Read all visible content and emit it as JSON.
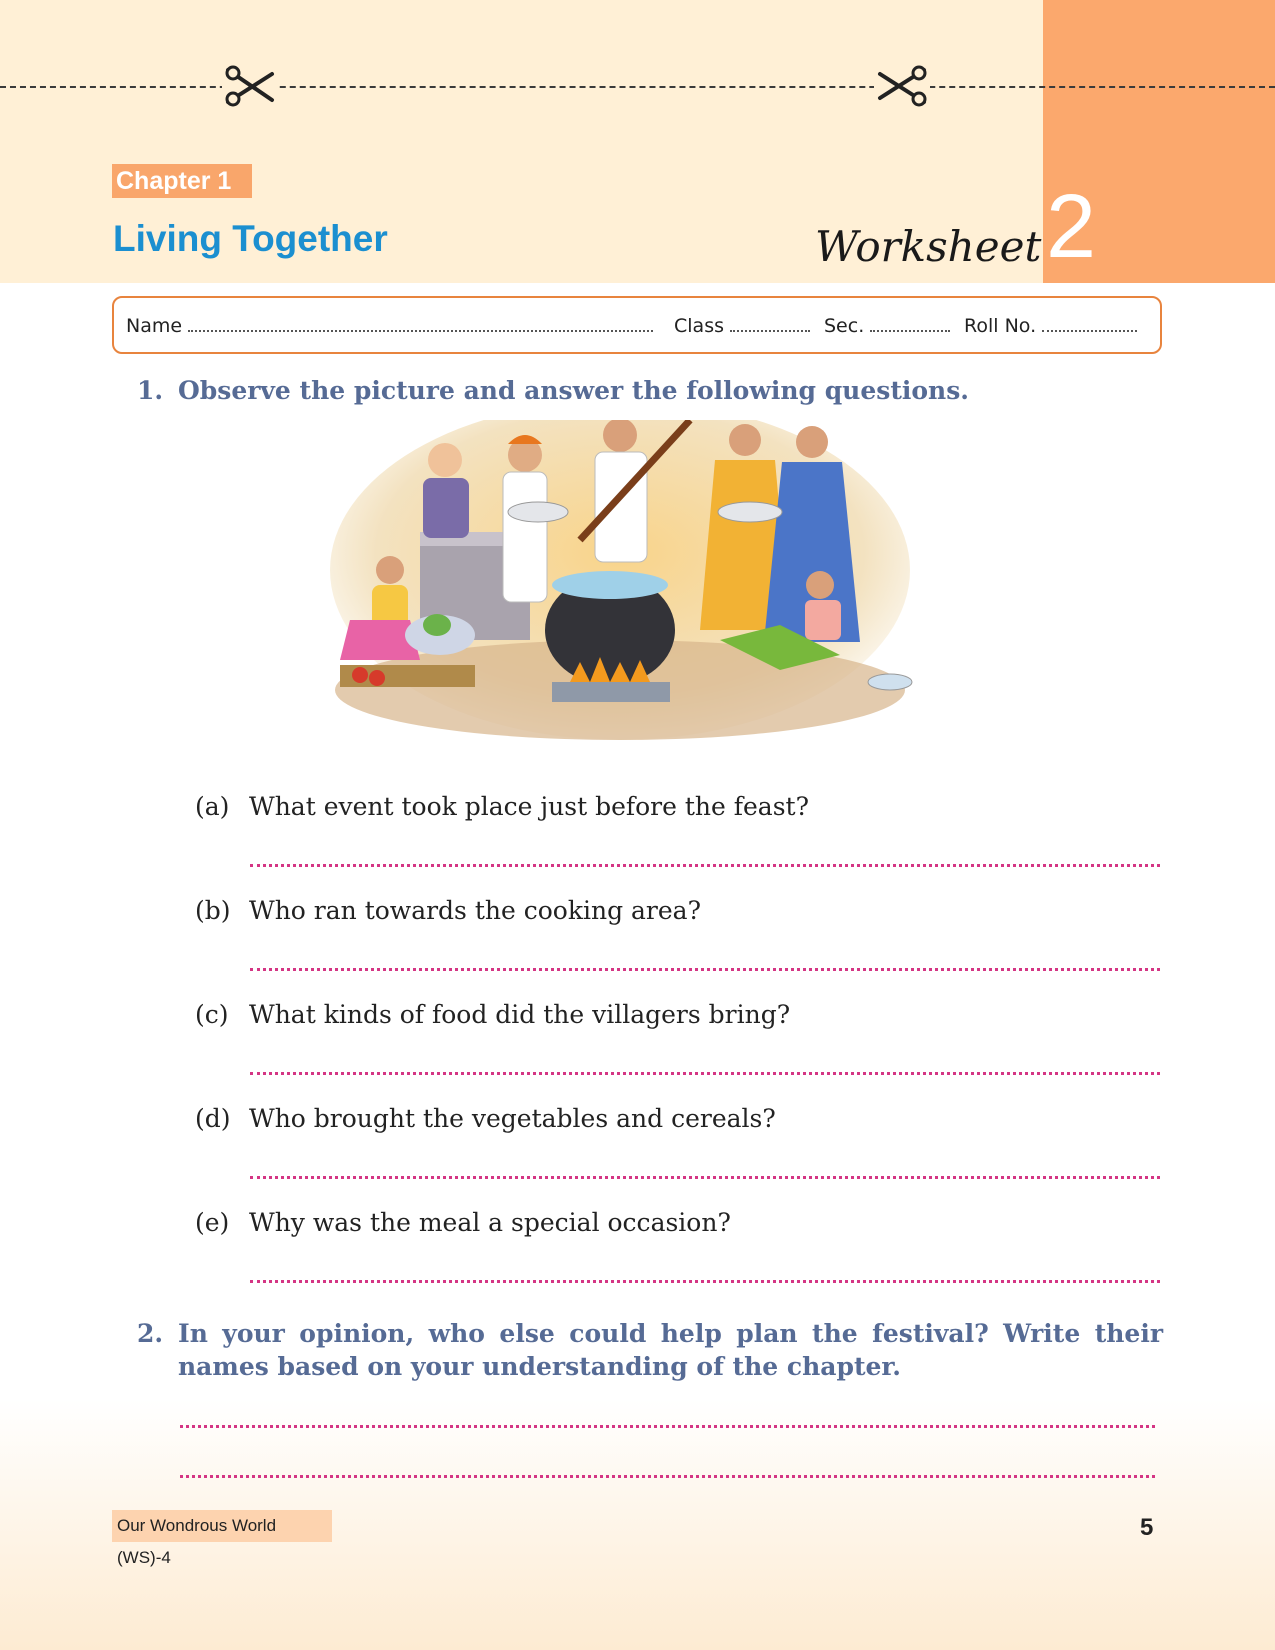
{
  "header": {
    "chapter_label": "Chapter 1",
    "chapter_title": "Living Together",
    "worksheet_word": "Worksheet",
    "worksheet_number": "2"
  },
  "student_info": {
    "name_label": "Name",
    "class_label": "Class",
    "sec_label": "Sec.",
    "roll_label": "Roll No."
  },
  "questions": [
    {
      "number": "1.",
      "text": "Observe the picture and answer the following questions.",
      "parts": [
        {
          "label": "(a)",
          "text": "What event took place just before the feast?"
        },
        {
          "label": "(b)",
          "text": "Who ran towards the cooking area?"
        },
        {
          "label": "(c)",
          "text": "What kinds of food did the villagers bring?"
        },
        {
          "label": "(d)",
          "text": "Who brought the vegetables and cereals?"
        },
        {
          "label": "(e)",
          "text": "Why was the meal a special occasion?"
        }
      ]
    },
    {
      "number": "2.",
      "text_line1": "In your opinion, who else could help plan the festival? Write their",
      "text_line2": "names based on your understanding of the chapter."
    }
  ],
  "footer": {
    "book_title": "Our Wondrous World (WS)-4",
    "page_number": "5"
  },
  "colors": {
    "header_bg": "#fff0d6",
    "orange_block": "#fba86d",
    "chapter_title": "#1b8fd0",
    "question_text": "#566b95",
    "answer_dots": "#d43584"
  },
  "icons": [
    "scissors-icon",
    "scissors-icon"
  ]
}
